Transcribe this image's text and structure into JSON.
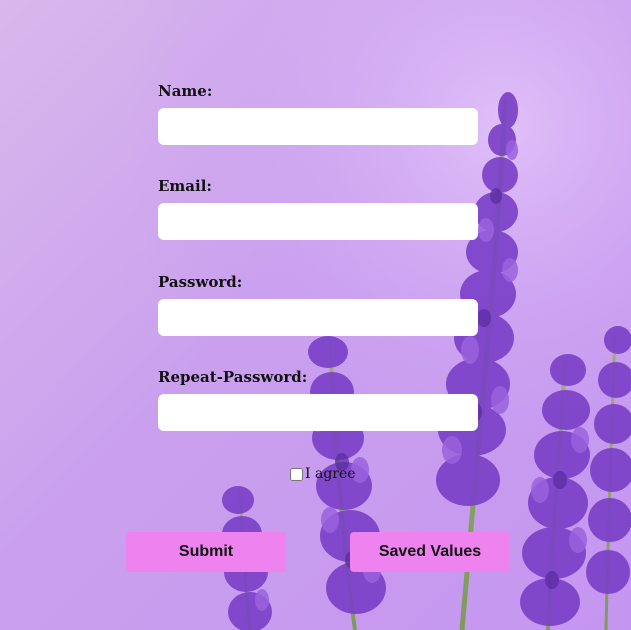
{
  "form": {
    "fields": [
      {
        "label": "Name:",
        "value": "",
        "placeholder": ""
      },
      {
        "label": "Email:",
        "value": "",
        "placeholder": ""
      },
      {
        "label": "Password:",
        "value": "",
        "placeholder": ""
      },
      {
        "label": "Repeat-Password:",
        "value": "",
        "placeholder": ""
      }
    ],
    "agree_label": "I agree",
    "agree_checked": false,
    "submit_label": "Submit",
    "saved_values_label": "Saved Values"
  },
  "colors": {
    "background": "#caa0ee",
    "button": "#ee82ee",
    "input": "#ffffff",
    "lavender": "#7a3fc8"
  }
}
